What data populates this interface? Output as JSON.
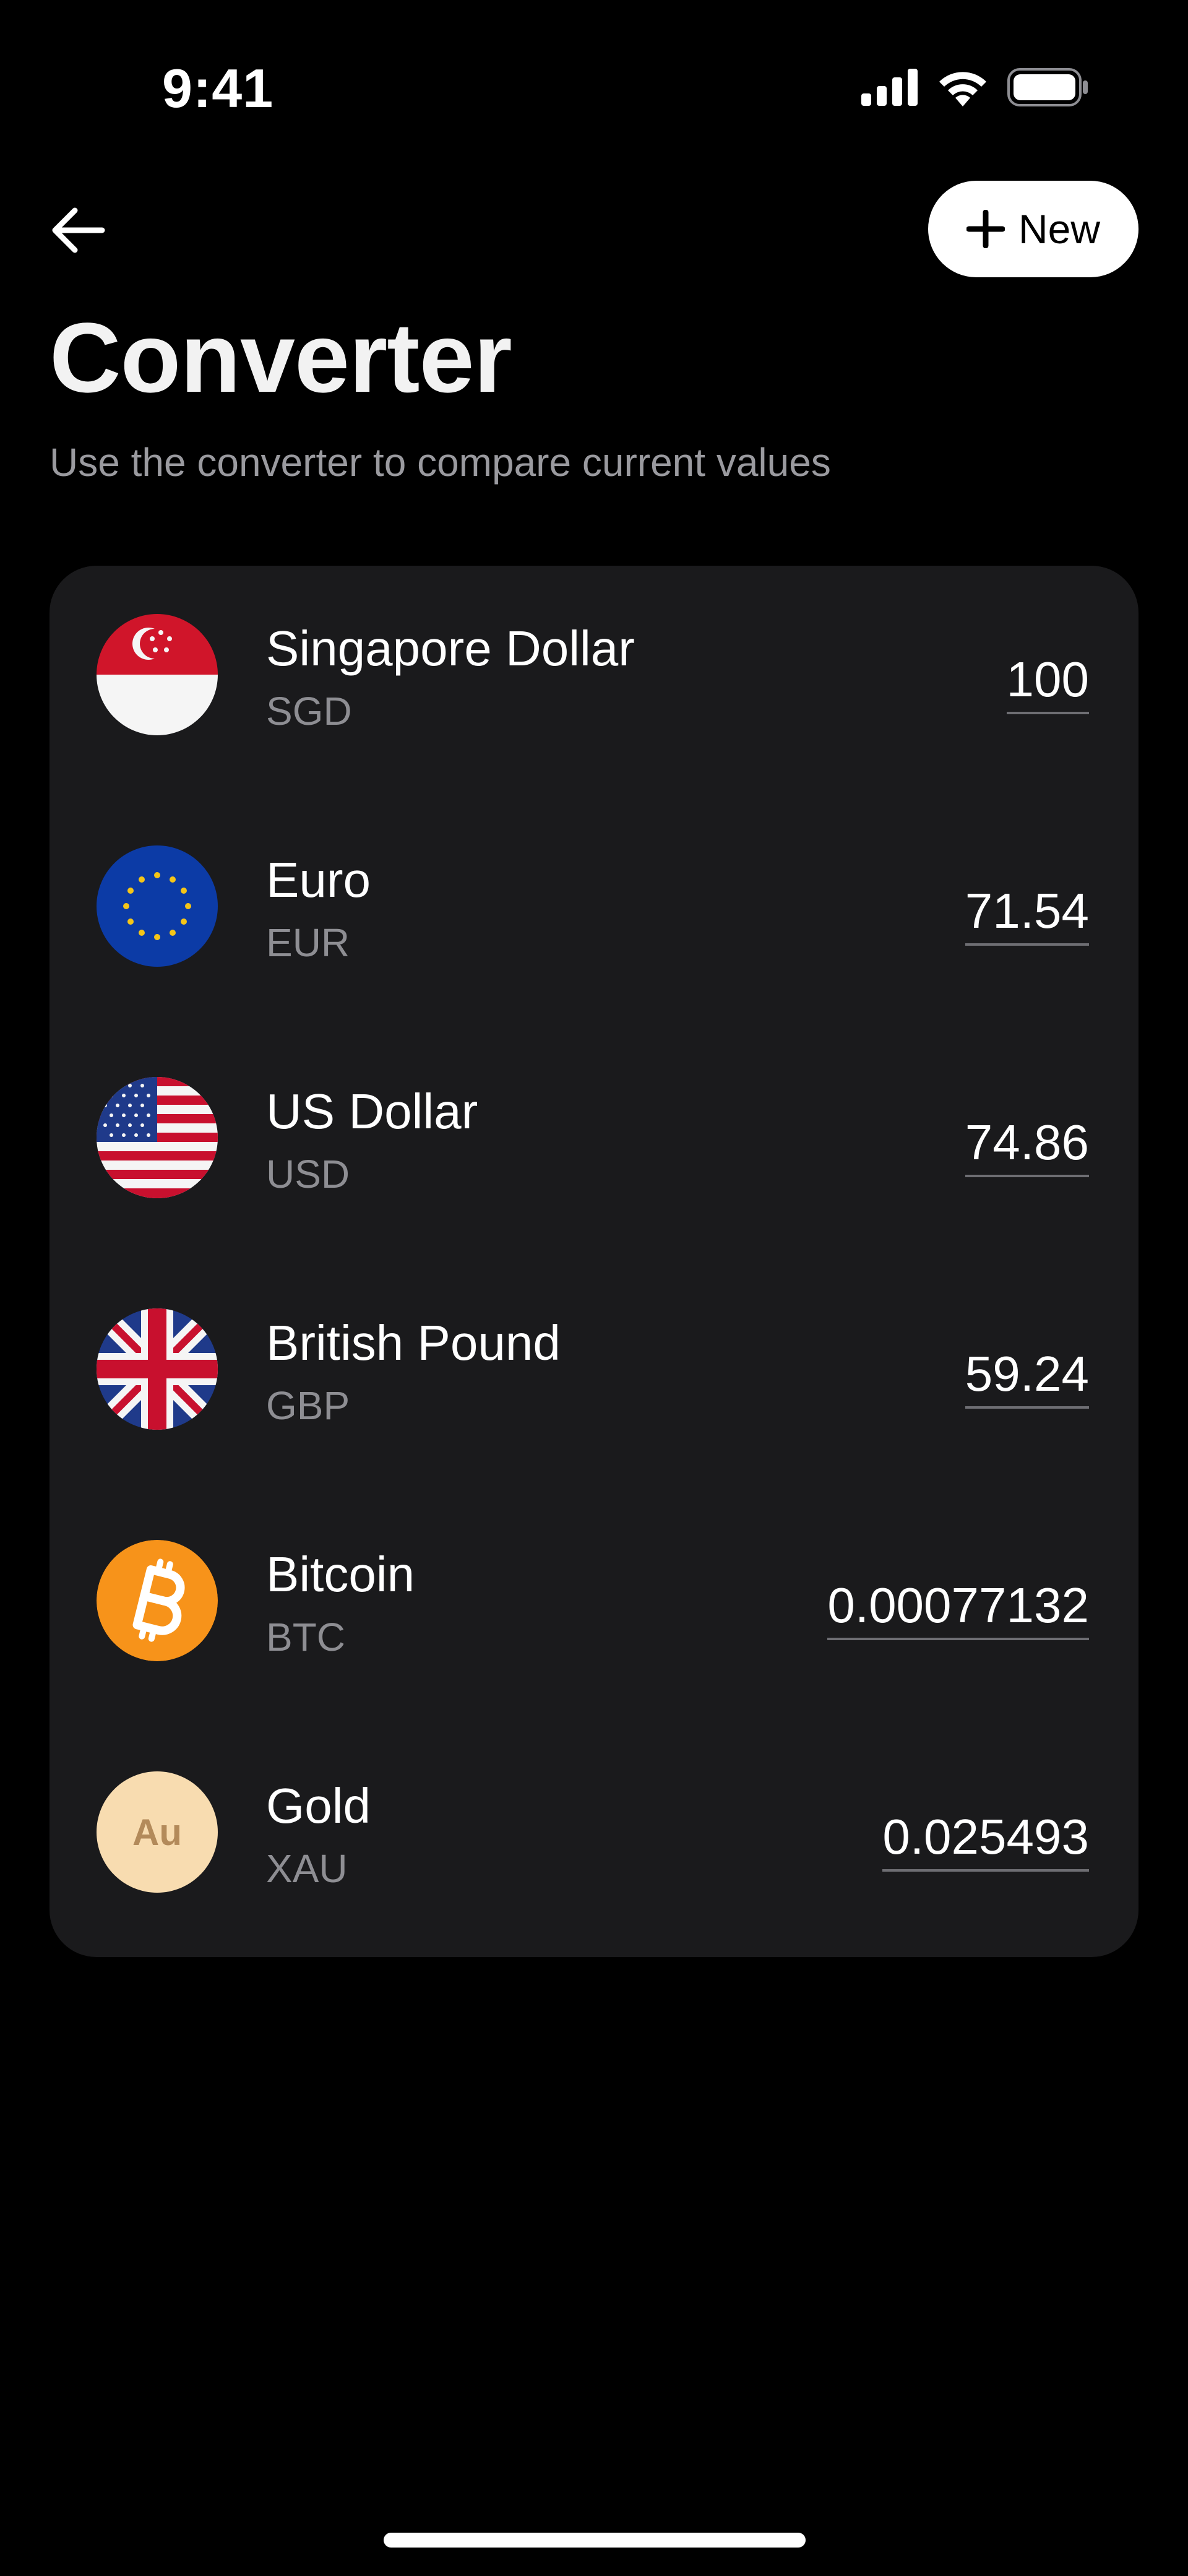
{
  "status_bar": {
    "time": "9:41"
  },
  "nav": {
    "new_label": "New"
  },
  "header": {
    "title": "Converter",
    "subtitle": "Use the converter to compare current values"
  },
  "currencies": [
    {
      "name": "Singapore Dollar",
      "code": "SGD",
      "amount": "100",
      "icon": "singapore-flag-icon"
    },
    {
      "name": "Euro",
      "code": "EUR",
      "amount": "71.54",
      "icon": "eu-flag-icon"
    },
    {
      "name": "US Dollar",
      "code": "USD",
      "amount": "74.86",
      "icon": "us-flag-icon"
    },
    {
      "name": "British Pound",
      "code": "GBP",
      "amount": "59.24",
      "icon": "uk-flag-icon"
    },
    {
      "name": "Bitcoin",
      "code": "BTC",
      "amount": "0.00077132",
      "icon": "bitcoin-icon"
    },
    {
      "name": "Gold",
      "code": "XAU",
      "amount": "0.025493",
      "icon": "gold-icon",
      "icon_text": "Au"
    }
  ],
  "colors": {
    "background": "#000000",
    "card": "#1a1a1c",
    "secondary_text": "#8e8e93",
    "bitcoin": "#f7931a",
    "gold": "#f8dcb0"
  }
}
